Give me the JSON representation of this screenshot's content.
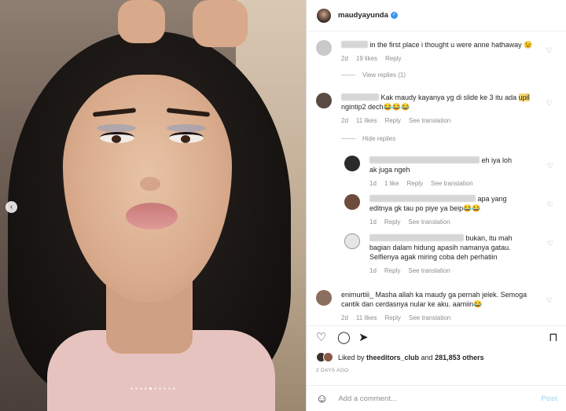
{
  "post": {
    "username": "maudyayunda",
    "verified_icon": "verified-badge-icon",
    "carousel_total": 10,
    "carousel_active": 4
  },
  "comments": [
    {
      "text": "in the first place i thought u were anne hathaway 😉",
      "age": "2d",
      "likes": "19 likes",
      "reply": "Reply",
      "view_replies": "View replies (1)"
    },
    {
      "text_before": "Kak maudy kayanya yg di slide ke 3 itu ada ",
      "highlight": "upil",
      "text_after": " ngintip2 dech😂😂😂",
      "age": "2d",
      "likes": "11 likes",
      "reply": "Reply",
      "translation": "See translation",
      "hide_replies": "Hide replies"
    }
  ],
  "replies": [
    {
      "text": "eh iya loh ak juga ngeh",
      "age": "1d",
      "likes": "1 like",
      "reply": "Reply",
      "translation": "See translation"
    },
    {
      "text": "apa yang editnya gk tau po piye ya beip😂😂",
      "age": "1d",
      "reply": "Reply",
      "translation": "See translation"
    },
    {
      "text": "bukan, itu mah bagian dalam hidung apasih namanya gatau. Selfienya agak miring coba deh perhatiin",
      "age": "1d",
      "reply": "Reply",
      "translation": "See translation"
    }
  ],
  "last_comment": {
    "username": "enimurtiii_",
    "text": "Masha allah ka maudy ga pernah jelek. Semoga cantik dan cerdasnya nular ke aku. aamiin😂",
    "age": "2d",
    "likes": "11 likes",
    "reply": "Reply",
    "translation": "See translation"
  },
  "likes_bar": {
    "prefix": "Liked by ",
    "liker": "theeditors_club",
    "middle": " and ",
    "count": "281,853 others"
  },
  "timestamp": "2 DAYS AGO",
  "add_comment": {
    "placeholder": "Add a comment...",
    "post_label": "Post"
  },
  "icons": [
    "heart-icon",
    "comment-icon",
    "share-icon",
    "save-icon",
    "emoji-icon",
    "carousel-prev-icon"
  ]
}
